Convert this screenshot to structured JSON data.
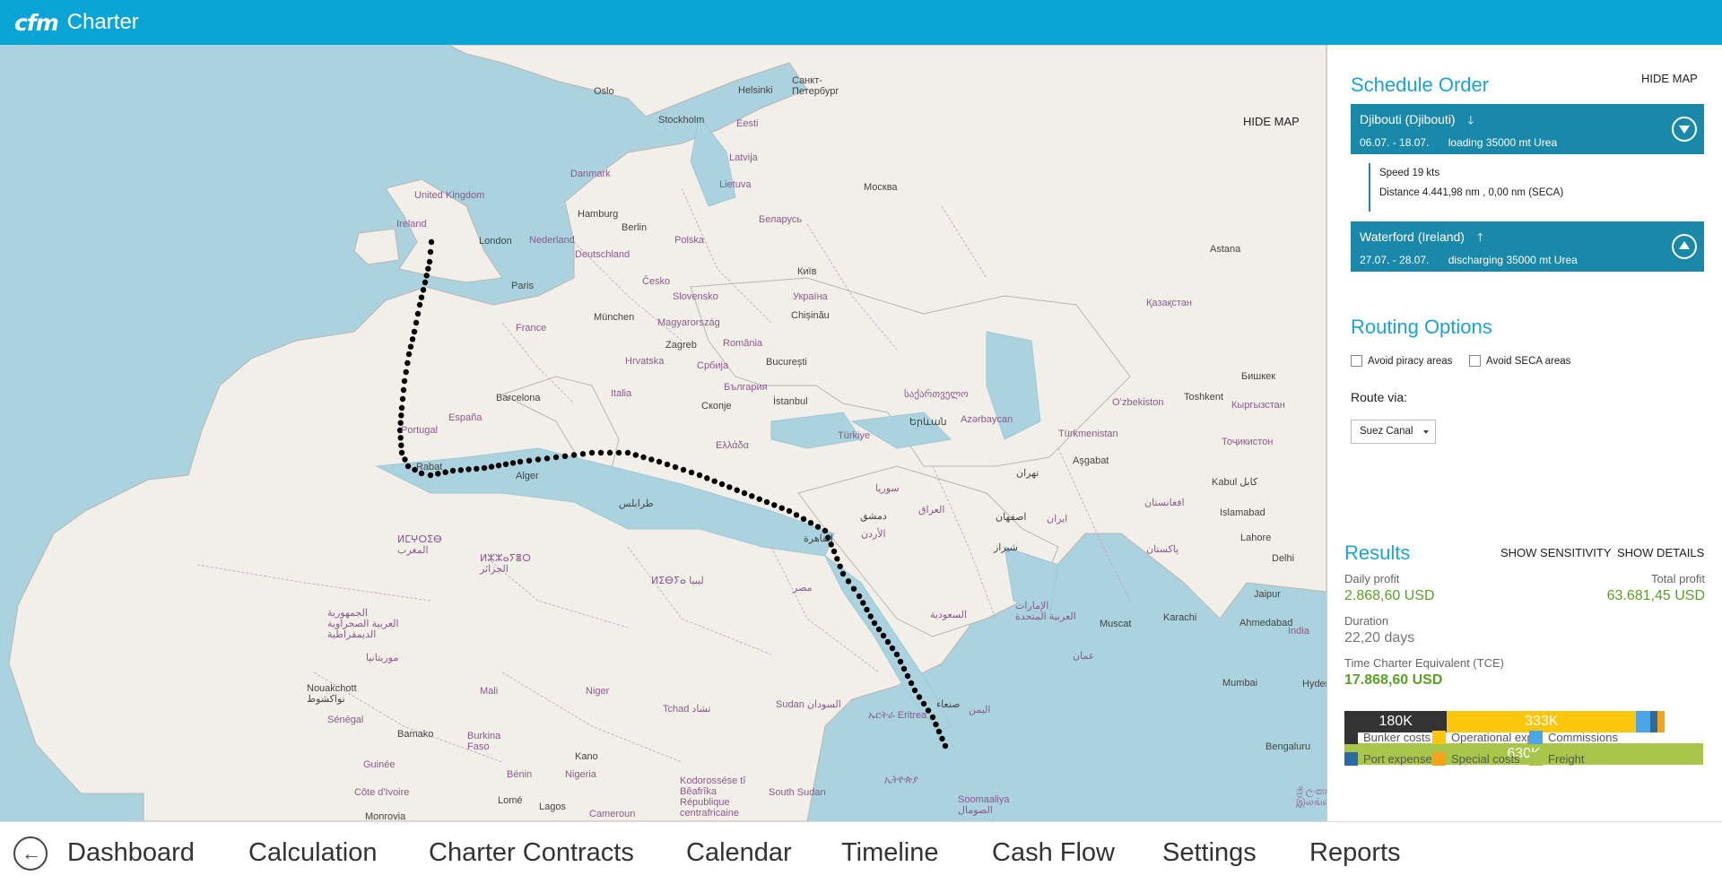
{
  "app": {
    "logo": "cfm",
    "title": "Charter"
  },
  "map": {
    "hide_label": "HIDE MAP",
    "labels": [
      {
        "text": "Oslo",
        "kind": "city"
      },
      {
        "text": "Helsinki",
        "kind": "city"
      },
      {
        "text": "Санкт-\nПетербург",
        "kind": "city"
      },
      {
        "text": "Stockholm",
        "kind": "city"
      },
      {
        "text": "Eesti",
        "kind": "country"
      },
      {
        "text": "Latvija",
        "kind": "country"
      },
      {
        "text": "Danmark",
        "kind": "country"
      },
      {
        "text": "Lietuva",
        "kind": "country"
      },
      {
        "text": "Москва",
        "kind": "city"
      },
      {
        "text": "United Kingdom",
        "kind": "country"
      },
      {
        "text": "Hamburg",
        "kind": "city"
      },
      {
        "text": "Беларусь",
        "kind": "country"
      },
      {
        "text": "Ireland",
        "kind": "country"
      },
      {
        "text": "Berlin",
        "kind": "city"
      },
      {
        "text": "London",
        "kind": "city"
      },
      {
        "text": "Nederland",
        "kind": "country"
      },
      {
        "text": "Polska",
        "kind": "country"
      },
      {
        "text": "Deutschland",
        "kind": "country"
      },
      {
        "text": "Astana",
        "kind": "city"
      },
      {
        "text": "Česko",
        "kind": "country"
      },
      {
        "text": "Київ",
        "kind": "city"
      },
      {
        "text": "Paris",
        "kind": "city"
      },
      {
        "text": "Slovensko",
        "kind": "country"
      },
      {
        "text": "Україна",
        "kind": "country"
      },
      {
        "text": "Қазақстан",
        "kind": "country"
      },
      {
        "text": "München",
        "kind": "city"
      },
      {
        "text": "Chișinău",
        "kind": "city"
      },
      {
        "text": "Magyarország",
        "kind": "country"
      },
      {
        "text": "France",
        "kind": "country"
      },
      {
        "text": "România",
        "kind": "country"
      },
      {
        "text": "Zagreb",
        "kind": "city"
      },
      {
        "text": "Hrvatska",
        "kind": "country"
      },
      {
        "text": "Србија",
        "kind": "country"
      },
      {
        "text": "București",
        "kind": "city"
      },
      {
        "text": "Бишкек",
        "kind": "city"
      },
      {
        "text": "Italia",
        "kind": "country"
      },
      {
        "text": "България",
        "kind": "country"
      },
      {
        "text": "Barcelona",
        "kind": "city"
      },
      {
        "text": "საქართველო",
        "kind": "country"
      },
      {
        "text": "Toshkent",
        "kind": "city"
      },
      {
        "text": "Oʻzbekiston",
        "kind": "country"
      },
      {
        "text": "Скопје",
        "kind": "city"
      },
      {
        "text": "İstanbul",
        "kind": "city"
      },
      {
        "text": "Кыргызстан",
        "kind": "country"
      },
      {
        "text": "España",
        "kind": "country"
      },
      {
        "text": "Երևան",
        "kind": "city"
      },
      {
        "text": "Azərbaycan",
        "kind": "country"
      },
      {
        "text": "Portugal",
        "kind": "country"
      },
      {
        "text": "Türkiye",
        "kind": "country"
      },
      {
        "text": "Türkmenistan",
        "kind": "country"
      },
      {
        "text": "Ελλάδα",
        "kind": "country"
      },
      {
        "text": "Тоҷикистон",
        "kind": "country"
      },
      {
        "text": "Rabat",
        "kind": "city"
      },
      {
        "text": "Alger",
        "kind": "city"
      },
      {
        "text": "Aşgabat",
        "kind": "city"
      },
      {
        "text": "Kabul کابل",
        "kind": "city"
      },
      {
        "text": "تهران",
        "kind": "city"
      },
      {
        "text": "سوريا",
        "kind": "country"
      },
      {
        "text": "طرابلس",
        "kind": "city"
      },
      {
        "text": "دمشق",
        "kind": "city"
      },
      {
        "text": "العراق",
        "kind": "country"
      },
      {
        "text": "اصفهان",
        "kind": "city"
      },
      {
        "text": "ایران",
        "kind": "country"
      },
      {
        "text": "افغانستان",
        "kind": "country"
      },
      {
        "text": "Islamabad",
        "kind": "city"
      },
      {
        "text": "الأردن",
        "kind": "country"
      },
      {
        "text": "القاهرة",
        "kind": "city"
      },
      {
        "text": "ⵍⵎⵖⵔⵉⴱ\nالمغرب",
        "kind": "country"
      },
      {
        "text": "Lahore",
        "kind": "city"
      },
      {
        "text": "شیراز",
        "kind": "city"
      },
      {
        "text": "ⵍⵣⵣⴰⵢⴻⵔ\nالجزائر",
        "kind": "country"
      },
      {
        "text": "پاکستان",
        "kind": "country"
      },
      {
        "text": "Delhi",
        "kind": "city"
      },
      {
        "text": "ⵍⵉⴱⵢⴰ ليبيا",
        "kind": "country"
      },
      {
        "text": "مصر",
        "kind": "country"
      },
      {
        "text": "Jaipur",
        "kind": "city"
      },
      {
        "text": "السعودية",
        "kind": "country"
      },
      {
        "text": "الإمارات\nالعربية المتحدة",
        "kind": "country"
      },
      {
        "text": "Karachi",
        "kind": "city"
      },
      {
        "text": "Ahmedabad",
        "kind": "city"
      },
      {
        "text": "الجمهورية\nالعربية الصحراوية\nالديمقراطية",
        "kind": "country"
      },
      {
        "text": "Muscat",
        "kind": "city"
      },
      {
        "text": "India",
        "kind": "country"
      },
      {
        "text": "موريتانيا",
        "kind": "country"
      },
      {
        "text": "عمان",
        "kind": "country"
      },
      {
        "text": "Mali",
        "kind": "country"
      },
      {
        "text": "Niger",
        "kind": "country"
      },
      {
        "text": "Mumbai",
        "kind": "city"
      },
      {
        "text": "Hyderabad",
        "kind": "city"
      },
      {
        "text": "Nouakchott\nنواكشوط",
        "kind": "city"
      },
      {
        "text": "Sudan السودان",
        "kind": "country"
      },
      {
        "text": "صنعاء",
        "kind": "city"
      },
      {
        "text": "Tchad تشاد",
        "kind": "country"
      },
      {
        "text": "Sénégal",
        "kind": "country"
      },
      {
        "text": "ኤርትራ Eritrea",
        "kind": "country"
      },
      {
        "text": "اليمن",
        "kind": "country"
      },
      {
        "text": "Bamako",
        "kind": "city"
      },
      {
        "text": "Burkina\nFaso",
        "kind": "country"
      },
      {
        "text": "Kano",
        "kind": "city"
      },
      {
        "text": "Bengaluru",
        "kind": "city"
      },
      {
        "text": "Guinée",
        "kind": "country"
      },
      {
        "text": "Bénin",
        "kind": "country"
      },
      {
        "text": "Nigeria",
        "kind": "country"
      },
      {
        "text": "ኢትዮጵያ",
        "kind": "country"
      },
      {
        "text": "Kodorossése tî\nBêafrîka\nRépublique\ncentrafricaine",
        "kind": "country"
      },
      {
        "text": "South Sudan",
        "kind": "country"
      },
      {
        "text": "Côte d'Ivoire",
        "kind": "country"
      },
      {
        "text": "Lomé",
        "kind": "city"
      },
      {
        "text": "Soomaaliya\nالصومال",
        "kind": "country"
      },
      {
        "text": "Monrovia",
        "kind": "city"
      },
      {
        "text": "Lagos",
        "kind": "city"
      },
      {
        "text": "Cameroun",
        "kind": "country"
      },
      {
        "text": "ශ්‍රී ලංකා\nஇலங்கை",
        "kind": "country"
      }
    ]
  },
  "panel": {
    "hide_label": "HIDE MAP",
    "schedule": {
      "title": "Schedule Order",
      "stops": [
        {
          "name": "Djibouti (Djibouti)",
          "arrow": "down-arrow-icon",
          "dates": "06.07. - 18.07.",
          "activity": "loading 35000 mt Urea",
          "toggle": "down"
        },
        {
          "name": "Waterford (Ireland)",
          "arrow": "up-arrow-icon",
          "dates": "27.07. - 28.07.",
          "activity": "discharging 35000 mt Urea",
          "toggle": "up"
        }
      ],
      "leg": {
        "speed": "Speed 19 kts",
        "distance": "Distance 4.441,98 nm ,  0,00 nm (SECA)"
      }
    },
    "routing": {
      "title": "Routing Options",
      "avoid_piracy": {
        "label": "Avoid piracy areas",
        "checked": false
      },
      "avoid_seca": {
        "label": "Avoid SECA areas",
        "checked": false
      },
      "route_via_label": "Route via:",
      "route_via_value": "Suez Canal"
    },
    "results": {
      "title": "Results",
      "show_sensitivity": "SHOW SENSITIVITY",
      "show_details": "SHOW DETAILS",
      "daily_profit_label": "Daily profit",
      "daily_profit": "2.868,60 USD",
      "total_profit_label": "Total profit",
      "total_profit": "63.681,45 USD",
      "duration_label": "Duration",
      "duration": "22,20 days",
      "tce_label": "Time Charter Equivalent (TCE)",
      "tce": "17.868,60 USD",
      "cost_bar": [
        {
          "label": "180K",
          "share": 0.286,
          "color": "#333333"
        },
        {
          "label": "333K",
          "share": 0.527,
          "color": "#fcc70a"
        },
        {
          "label": "",
          "share": 0.04,
          "color": "#4aa6e6"
        },
        {
          "label": "",
          "share": 0.02,
          "color": "#2a6aa0"
        },
        {
          "label": "",
          "share": 0.02,
          "color": "#f7a21b"
        }
      ],
      "freight_bar": {
        "label": "630K",
        "color": "#a8c64a"
      },
      "legend": [
        {
          "label": "Bunker costs",
          "color": "#333333"
        },
        {
          "label": "Operational exp.",
          "color": "#fcc70a"
        },
        {
          "label": "Commissions",
          "color": "#4aa6e6"
        },
        {
          "label": "Port expenses",
          "color": "#2a6aa0"
        },
        {
          "label": "Special costs",
          "color": "#f7a21b"
        },
        {
          "label": "Freight",
          "color": "#a8c64a"
        }
      ]
    }
  },
  "nav": {
    "back_icon": "back-arrow-icon",
    "items": [
      "Dashboard",
      "Calculation",
      "Charter Contracts",
      "Calendar",
      "Timeline",
      "Cash Flow",
      "Settings",
      "Reports"
    ]
  }
}
